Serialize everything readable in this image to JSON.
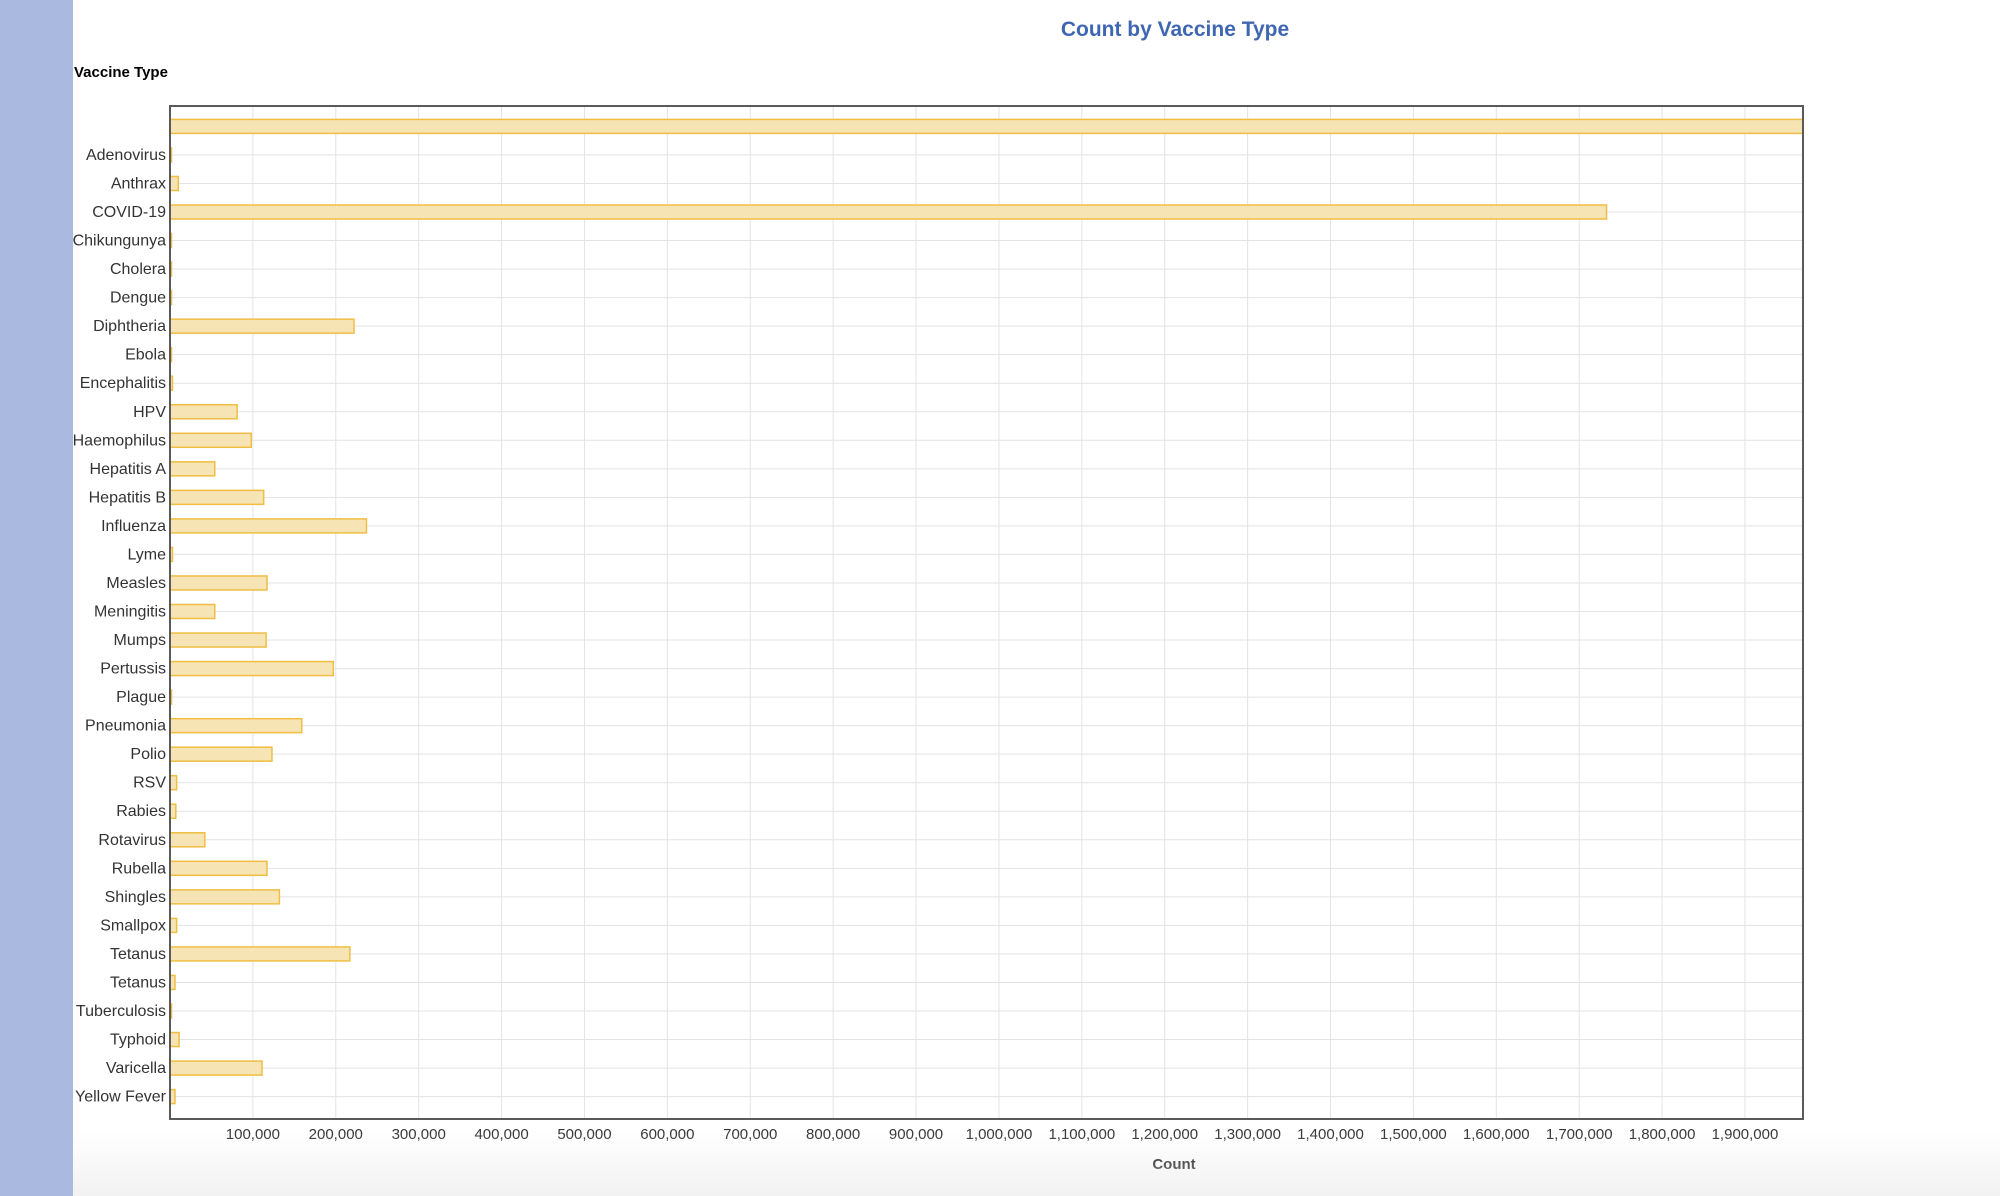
{
  "colors": {
    "left_strip": "#a9b9e0",
    "title": "#3f67b1",
    "bar_fill": "#f7e4b4",
    "bar_stroke": "#efbe43",
    "grid": "#e3e3e3",
    "frame": "#5a5a5a"
  },
  "chart_data": {
    "type": "bar",
    "orientation": "horizontal",
    "title": "Count by Vaccine Type",
    "xlabel": "Count",
    "ylabel": "Vaccine Type",
    "xlim": [
      0,
      1970000
    ],
    "xticks": [
      100000,
      200000,
      300000,
      400000,
      500000,
      600000,
      700000,
      800000,
      900000,
      1000000,
      1100000,
      1200000,
      1300000,
      1400000,
      1500000,
      1600000,
      1700000,
      1800000,
      1900000
    ],
    "xtick_labels": [
      "100,000",
      "200,000",
      "300,000",
      "400,000",
      "500,000",
      "600,000",
      "700,000",
      "800,000",
      "900,000",
      "1,000,000",
      "1,100,000",
      "1,200,000",
      "1,300,000",
      "1,400,000",
      "1,500,000",
      "1,600,000",
      "1,700,000",
      "1,800,000",
      "1,900,000"
    ],
    "grid": true,
    "categories": [
      "",
      "Adenovirus",
      "Anthrax",
      "COVID-19",
      "Chikungunya",
      "Cholera",
      "Dengue",
      "Diphtheria",
      "Ebola",
      "Encephalitis",
      "HPV",
      "Haemophilus",
      "Hepatitis A",
      "Hepatitis B",
      "Influenza",
      "Lyme",
      "Measles",
      "Meningitis",
      "Mumps",
      "Pertussis",
      "Plague",
      "Pneumonia",
      "Polio",
      "RSV",
      "Rabies",
      "Rotavirus",
      "Rubella",
      "Shingles",
      "Smallpox",
      "Tetanus",
      "Tetanus",
      "Tuberculosis",
      "Typhoid",
      "Varicella",
      "Yellow Fever"
    ],
    "values": [
      1970000,
      1000,
      10000,
      1733000,
      500,
      800,
      1000,
      222000,
      200,
      3000,
      81000,
      98000,
      54000,
      113000,
      237000,
      3000,
      117000,
      54000,
      116000,
      197000,
      500,
      159000,
      123000,
      8000,
      7000,
      42000,
      117000,
      132000,
      8000,
      217000,
      6000,
      1000,
      11000,
      111000,
      6000
    ]
  }
}
